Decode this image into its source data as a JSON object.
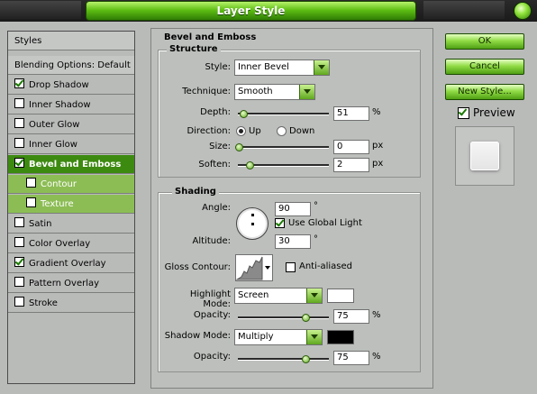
{
  "title": "Layer Style",
  "sidebar": {
    "header": "Styles",
    "blending": "Blending Options: Default",
    "items": [
      {
        "label": "Drop Shadow",
        "checked": true
      },
      {
        "label": "Inner Shadow",
        "checked": false
      },
      {
        "label": "Outer Glow",
        "checked": false
      },
      {
        "label": "Inner Glow",
        "checked": false
      },
      {
        "label": "Bevel and Emboss",
        "checked": true
      },
      {
        "label": "Contour",
        "checked": false
      },
      {
        "label": "Texture",
        "checked": false
      },
      {
        "label": "Satin",
        "checked": false
      },
      {
        "label": "Color Overlay",
        "checked": false
      },
      {
        "label": "Gradient Overlay",
        "checked": true
      },
      {
        "label": "Pattern Overlay",
        "checked": false
      },
      {
        "label": "Stroke",
        "checked": false
      }
    ]
  },
  "bevel": {
    "section_title": "Bevel and Emboss",
    "structure_title": "Structure",
    "style_label": "Style:",
    "style_value": "Inner Bevel",
    "technique_label": "Technique:",
    "technique_value": "Smooth",
    "depth_label": "Depth:",
    "depth_value": "51",
    "depth_unit": "%",
    "direction_label": "Direction:",
    "dir_up": "Up",
    "dir_down": "Down",
    "direction_selected": "Up",
    "size_label": "Size:",
    "size_value": "0",
    "size_unit": "px",
    "soften_label": "Soften:",
    "soften_value": "2",
    "soften_unit": "px"
  },
  "shading": {
    "title": "Shading",
    "angle_label": "Angle:",
    "angle_value": "90",
    "angle_unit": "°",
    "global_light_label": "Use Global Light",
    "global_light_checked": true,
    "altitude_label": "Altitude:",
    "altitude_value": "30",
    "altitude_unit": "°",
    "gloss_label": "Gloss Contour:",
    "anti_aliased_label": "Anti-aliased",
    "anti_aliased_checked": false,
    "highlight_mode_label": "Highlight Mode:",
    "highlight_mode_value": "Screen",
    "highlight_color": "#ffffff",
    "highlight_opacity_label": "Opacity:",
    "highlight_opacity_value": "75",
    "highlight_opacity_unit": "%",
    "shadow_mode_label": "Shadow Mode:",
    "shadow_mode_value": "Multiply",
    "shadow_color": "#000000",
    "shadow_opacity_label": "Opacity:",
    "shadow_opacity_value": "75",
    "shadow_opacity_unit": "%"
  },
  "buttons": {
    "ok": "OK",
    "cancel": "Cancel",
    "new_style": "New Style..."
  },
  "preview": {
    "label": "Preview",
    "checked": true
  },
  "theme": {
    "accent": "#3d8a10",
    "accent_light": "#8cbd55"
  }
}
